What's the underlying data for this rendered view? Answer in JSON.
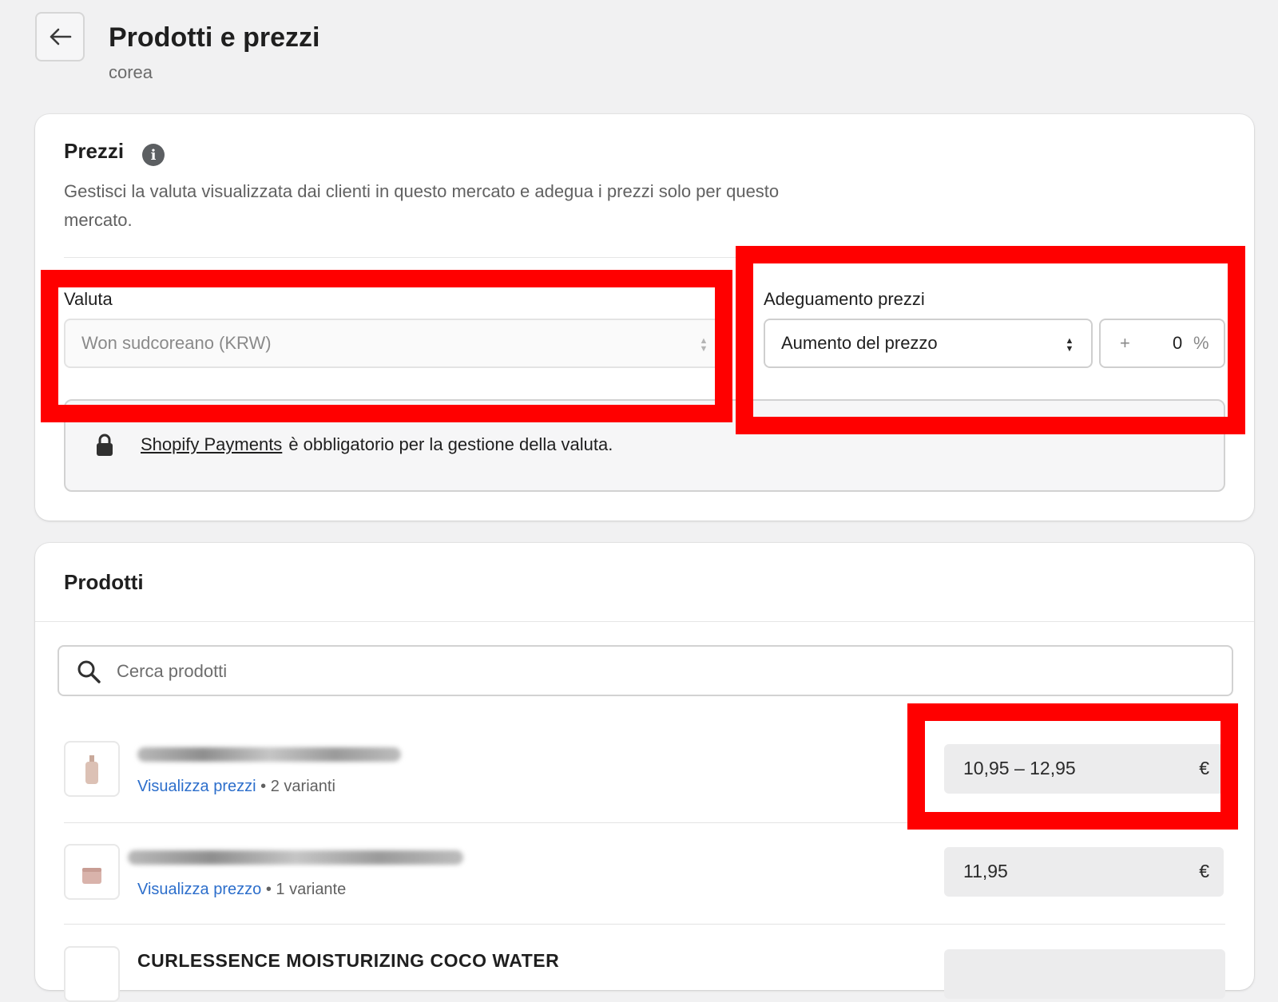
{
  "header": {
    "title": "Prodotti e prezzi",
    "subtitle": "corea"
  },
  "pricing": {
    "title": "Prezzi",
    "description": "Gestisci la valuta visualizzata dai clienti in questo mercato e adegua i prezzi solo per questo mercato.",
    "currency": {
      "label": "Valuta",
      "selected": "Won sudcoreano (KRW)"
    },
    "adjustment": {
      "label": "Adeguamento prezzi",
      "selected": "Aumento del prezzo",
      "sign": "+",
      "value": "0",
      "unit": "%"
    },
    "notice": {
      "link": "Shopify Payments",
      "text": "è obbligatorio per la gestione della valuta."
    }
  },
  "products": {
    "title": "Prodotti",
    "search_placeholder": "Cerca prodotti",
    "rows": [
      {
        "link": "Visualizza prezzi",
        "separator": "•",
        "variants": "2 varianti",
        "price": "10,95 – 12,95",
        "currency": "€"
      },
      {
        "link": "Visualizza prezzo",
        "separator": "•",
        "variants": "1 variante",
        "price": "11,95",
        "currency": "€"
      }
    ],
    "partial_row_title": "CURLESSENCE MOISTURIZING COCO WATER"
  },
  "colors": {
    "highlight": "#ff0000",
    "link": "#2c6ecb",
    "background": "#f1f1f2"
  }
}
